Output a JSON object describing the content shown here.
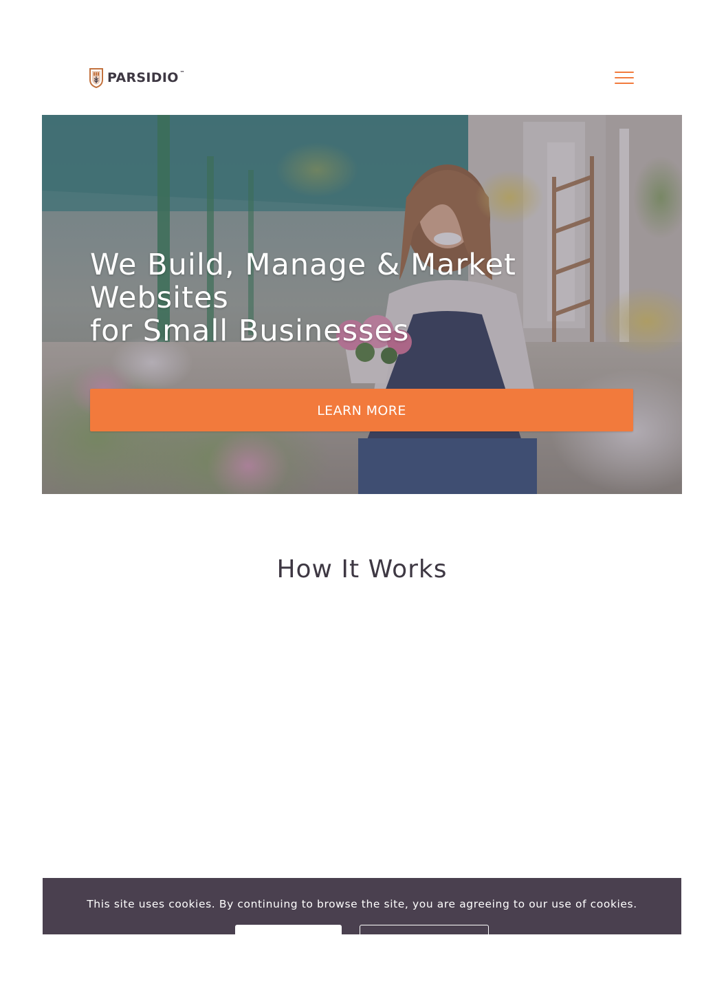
{
  "header": {
    "logo_text": "PARSIDIO",
    "logo_tm": "™",
    "logo_icon": "shield-icon",
    "menu_icon": "hamburger-menu-icon"
  },
  "hero": {
    "title_lines": [
      "We Build, Manage & Market",
      "Websites",
      "for Small Businesses"
    ],
    "cta_label": "LEARN MORE"
  },
  "how_it_works": {
    "title": "How It Works"
  },
  "cookie_banner": {
    "message": "This site uses cookies. By continuing to browse the site, you are agreeing to our use of cookies."
  },
  "colors": {
    "accent": "#f27a3c",
    "dark": "#3e3843",
    "banner": "#4a404f",
    "white": "#ffffff"
  }
}
